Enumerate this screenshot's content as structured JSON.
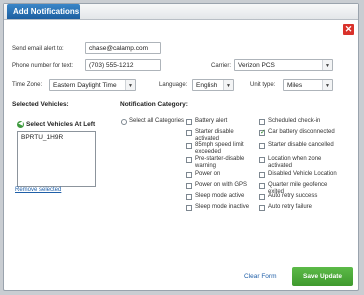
{
  "dialog": {
    "tab_title": "Add Notifications",
    "close_symbol": "✕"
  },
  "form": {
    "email_label": "Send email alert to:",
    "email_value": "chase@calamp.com",
    "phone_label": "Phone number for text:",
    "phone_value": "(703) 555-1212",
    "carrier_label": "Carrier:",
    "carrier_value": "Verizon PCS",
    "timezone_label": "Time Zone:",
    "timezone_value": "Eastern Daylight Time",
    "language_label": "Language:",
    "language_value": "English",
    "unittype_label": "Unit type:",
    "unittype_value": "Miles"
  },
  "vehicles": {
    "title": "Selected Vehicles:",
    "select_left_label": "Select Vehicles At Left",
    "items": [
      "BPRTU_1H9R"
    ],
    "remove_label": "Remove selected"
  },
  "categories": {
    "title": "Notification Category:",
    "select_all_label": "Select all Categories",
    "col1": [
      {
        "label": "Battery alert",
        "checked": false
      },
      {
        "label": "Starter disable activated",
        "checked": false
      },
      {
        "label": "85mph speed limit exceeded",
        "checked": false
      },
      {
        "label": "Pre-starter-disable warning",
        "checked": false
      },
      {
        "label": "Power on",
        "checked": false
      },
      {
        "label": "Power on with GPS",
        "checked": false
      },
      {
        "label": "Sleep mode active",
        "checked": false
      },
      {
        "label": "Sleep mode inactive",
        "checked": false
      }
    ],
    "col2": [
      {
        "label": "Scheduled check-in",
        "checked": false
      },
      {
        "label": "Car battery disconnected",
        "checked": true
      },
      {
        "label": "Starter disable cancelled",
        "checked": false
      },
      {
        "label": "Location when zone activated",
        "checked": false
      },
      {
        "label": "Disabled Vehicle Location",
        "checked": false
      },
      {
        "label": "Quarter mile geofence exited",
        "checked": false
      },
      {
        "label": "Auto retry success",
        "checked": false
      },
      {
        "label": "Auto retry failure",
        "checked": false
      }
    ]
  },
  "actions": {
    "clear_label": "Clear Form",
    "save_label": "Save Update"
  },
  "colors": {
    "accent": "#2a73b8",
    "save": "#4caa3a",
    "close": "#d9322b"
  }
}
